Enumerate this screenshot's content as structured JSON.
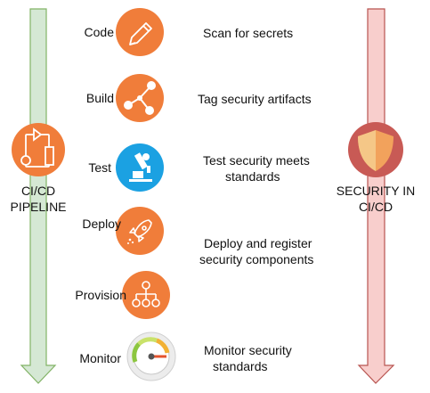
{
  "left_column": {
    "title_line1": "CI/CD",
    "title_line2": "PIPELINE",
    "arrow_color": "#d5e8d4",
    "arrow_stroke": "#82b366"
  },
  "right_column": {
    "title_line1": "SECURITY IN",
    "title_line2": "CI/CD",
    "arrow_color": "#f8cecc",
    "arrow_stroke": "#b85450"
  },
  "stages": [
    {
      "label": "Code",
      "icon": "pencil-icon",
      "color": "#f07d3a",
      "desc": [
        "Scan for secrets"
      ]
    },
    {
      "label": "Build",
      "icon": "share-nodes-icon",
      "color": "#f07d3a",
      "desc": [
        "Tag security artifacts"
      ]
    },
    {
      "label": "Test",
      "icon": "microscope-icon",
      "color": "#1ba1e2",
      "desc": [
        "Test security meets",
        "standards"
      ]
    },
    {
      "label": "Deploy",
      "icon": "rocket-icon",
      "color": "#f07d3a",
      "desc": [
        "Deploy and register",
        "security components"
      ]
    },
    {
      "label": "Provision",
      "icon": "hierarchy-icon",
      "color": "#f07d3a",
      "desc": []
    },
    {
      "label": "Monitor",
      "icon": "gauge-icon",
      "color": "#e6e6e6",
      "desc": [
        "Monitor security",
        "standards"
      ]
    }
  ]
}
